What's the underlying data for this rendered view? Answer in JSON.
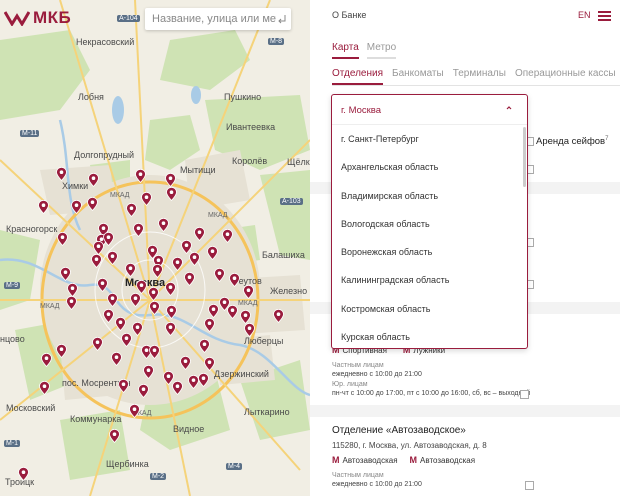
{
  "brand": {
    "name": "МКБ",
    "color": "#9a1c3d"
  },
  "search": {
    "placeholder": "Название, улица или метро"
  },
  "map": {
    "labels": [
      {
        "id": "nekrasovsky",
        "text": "Некрасовский"
      },
      {
        "id": "lobnya",
        "text": "Лобня"
      },
      {
        "id": "dolgoprudny",
        "text": "Долгопрудный"
      },
      {
        "id": "khimki",
        "text": "Химки"
      },
      {
        "id": "krasnogorsk",
        "text": "Красногорск"
      },
      {
        "id": "moskva",
        "text": "Москва"
      },
      {
        "id": "pushkino",
        "text": "Пушкино"
      },
      {
        "id": "ivanteevka",
        "text": "Ивантеевка"
      },
      {
        "id": "mytishchi",
        "text": "Мытищи"
      },
      {
        "id": "korolev",
        "text": "Королёв"
      },
      {
        "id": "shchelkovo",
        "text": "Щёлко"
      },
      {
        "id": "balashikha",
        "text": "Балашиха"
      },
      {
        "id": "reutov",
        "text": "Реутов"
      },
      {
        "id": "zheleznodor",
        "text": "Железно"
      },
      {
        "id": "lyubertsy",
        "text": "Люберцы"
      },
      {
        "id": "dzerzhinsky",
        "text": "Дзержинский"
      },
      {
        "id": "lytkarino",
        "text": "Лыткарино"
      },
      {
        "id": "vidnoe",
        "text": "Видное"
      },
      {
        "id": "moskovsky",
        "text": "Московский"
      },
      {
        "id": "mosrentgen",
        "text": "пос. Мосрентген"
      },
      {
        "id": "kommunarka",
        "text": "Коммунарка"
      },
      {
        "id": "sherbinka",
        "text": "Щербинка"
      },
      {
        "id": "troitsk",
        "text": "Троицк"
      },
      {
        "id": "odintsovo",
        "text": "нцово"
      },
      {
        "id": "mkad1",
        "text": "МКАД"
      },
      {
        "id": "mkad2",
        "text": "МКАД"
      },
      {
        "id": "mkad3",
        "text": "МКАД"
      },
      {
        "id": "mkad4",
        "text": "МКАД"
      },
      {
        "id": "mkad5",
        "text": "МКАД"
      },
      {
        "id": "a104",
        "text": "А-104"
      },
      {
        "id": "m8",
        "text": "М-8"
      },
      {
        "id": "a103",
        "text": "А-103"
      },
      {
        "id": "m11",
        "text": "М-11"
      },
      {
        "id": "m2",
        "text": "М-2"
      },
      {
        "id": "m4",
        "text": "М-4"
      },
      {
        "id": "m9",
        "text": "М-9"
      },
      {
        "id": "m1",
        "text": "М-1"
      }
    ]
  },
  "header": {
    "about_label": "О Банке",
    "lang_label": "EN"
  },
  "view_tabs": [
    {
      "label": "Карта",
      "active": true
    },
    {
      "label": "Метро",
      "active": false
    }
  ],
  "type_tabs": [
    {
      "label": "Отделения",
      "active": true
    },
    {
      "label": "Банкоматы",
      "active": false
    },
    {
      "label": "Терминалы",
      "active": false
    },
    {
      "label": "Операционные кассы",
      "active": false
    }
  ],
  "filters": {
    "safe_rental_label": "Аренда сейфов",
    "safe_rental_mark": "7"
  },
  "city_select": {
    "selected": "г. Москва",
    "options": [
      "г. Санкт-Петербург",
      "Архангельская область",
      "Владимирская область",
      "Вологодская область",
      "Воронежская область",
      "Калининградская область",
      "Костромская область",
      "Курская область"
    ]
  },
  "branch_prev": {
    "metro": [
      {
        "letter": "М",
        "name": "Спортивная"
      },
      {
        "letter": "М",
        "name": "Лужники"
      }
    ],
    "individuals_label": "Частным лицам",
    "individuals_hours": "ежедневно с 10:00 до 21:00",
    "legal_label": "Юр. лицам",
    "legal_hours": "пн-чт с 10:00 до 17:00, пт с 10:00 до 16:00, сб, вс – выходной"
  },
  "branch_next": {
    "title": "Отделение «Автозаводское»",
    "address": "115280, г. Москва, ул. Автозаводская, д. 8",
    "metro": [
      {
        "letter": "М",
        "name": "Автозаводская"
      },
      {
        "letter": "М",
        "name": "Автозаводская"
      }
    ],
    "individuals_label": "Частным лицам",
    "individuals_hours": "ежедневно с 10:00 до 21:00"
  }
}
